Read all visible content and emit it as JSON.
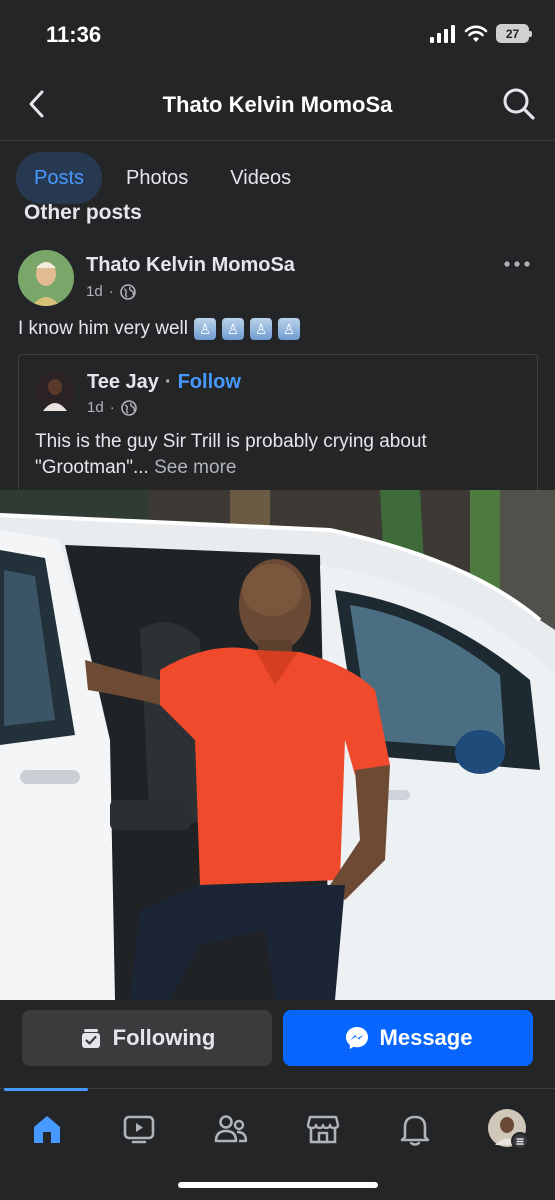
{
  "status_bar": {
    "time": "11:36",
    "battery": "27"
  },
  "header": {
    "title": "Thato Kelvin MomoSa"
  },
  "tabs": [
    {
      "label": "Posts",
      "active": true
    },
    {
      "label": "Photos",
      "active": false
    },
    {
      "label": "Videos",
      "active": false
    }
  ],
  "section": {
    "title": "Other posts"
  },
  "post": {
    "author": "Thato Kelvin MomoSa",
    "time": "1d",
    "separator": "·",
    "text": "I know him very well",
    "emoji_count": 4,
    "shared": {
      "author": "Tee Jay",
      "separator": "·",
      "follow_label": "Follow",
      "time": "1d",
      "text": "This is the guy Sir Trill is probably crying about \"Grootman\"...",
      "see_more": "See more"
    }
  },
  "actions": {
    "following_label": "Following",
    "message_label": "Message"
  },
  "nav": [
    "home-icon",
    "video-icon",
    "friends-icon",
    "marketplace-icon",
    "bell-icon",
    "profile-avatar"
  ],
  "colors": {
    "background": "#242526",
    "accent": "#4599ff",
    "message_button": "#0866ff"
  }
}
